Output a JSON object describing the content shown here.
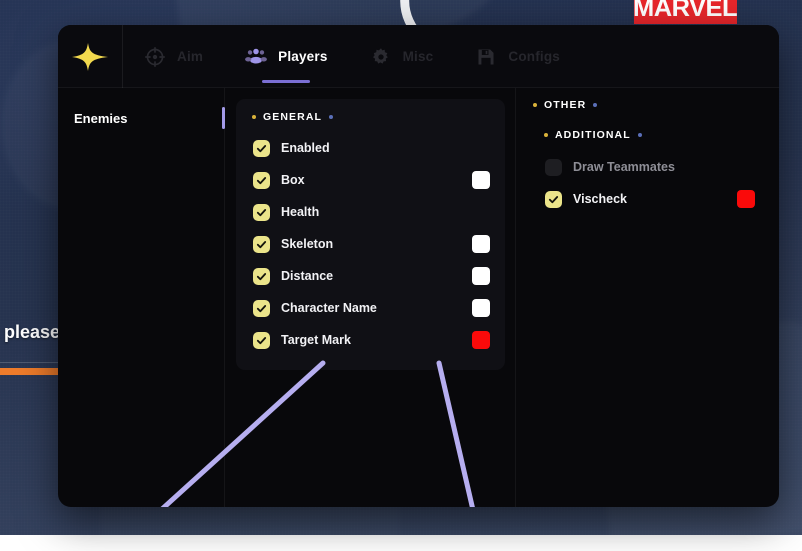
{
  "background": {
    "hud_text": ", please",
    "logo_text": "MARVEL",
    "accent_orange": "#ef7c2b",
    "backdrop_color": "#283453",
    "esp_line_color": "#b6aef0"
  },
  "window": {
    "accent_purple": "#7b6fd4",
    "surface": "#08080b",
    "card_surface": "#101015"
  },
  "tabs": {
    "brand_icon": "sparkle-icon",
    "items": [
      {
        "label": "Aim",
        "icon": "crosshair-icon",
        "active": false
      },
      {
        "label": "Players",
        "icon": "players-icon",
        "active": true
      },
      {
        "label": "Misc",
        "icon": "gear-icon",
        "active": false
      },
      {
        "label": "Configs",
        "icon": "floppy-disk-icon",
        "active": false
      }
    ]
  },
  "sidebar": {
    "items": [
      {
        "label": "Enemies",
        "active": true
      }
    ]
  },
  "middle_panel": {
    "group": {
      "title": "GENERAL",
      "left_dot_color": "#d9b23a",
      "right_dot_color": "#5a6fb8",
      "options": [
        {
          "label": "Enabled",
          "checked": true,
          "swatch": null
        },
        {
          "label": "Box",
          "checked": true,
          "swatch": "#ffffff"
        },
        {
          "label": "Health",
          "checked": true,
          "swatch": null
        },
        {
          "label": "Skeleton",
          "checked": true,
          "swatch": "#ffffff"
        },
        {
          "label": "Distance",
          "checked": true,
          "swatch": "#ffffff"
        },
        {
          "label": "Character Name",
          "checked": true,
          "swatch": "#ffffff"
        },
        {
          "label": "Target Mark",
          "checked": true,
          "swatch": "#fa0a0a"
        }
      ]
    }
  },
  "right_panel": {
    "group": {
      "title": "OTHER",
      "left_dot_color": "#d9b23a",
      "right_dot_color": "#5a6fb8"
    },
    "subgroup": {
      "title": "ADDITIONAL",
      "left_dot_color": "#d9b23a",
      "right_dot_color": "#5a6fb8",
      "options": [
        {
          "label": "Draw Teammates",
          "checked": false,
          "swatch": null
        },
        {
          "label": "Vischeck",
          "checked": true,
          "swatch": "#fa0a0a"
        }
      ]
    }
  }
}
